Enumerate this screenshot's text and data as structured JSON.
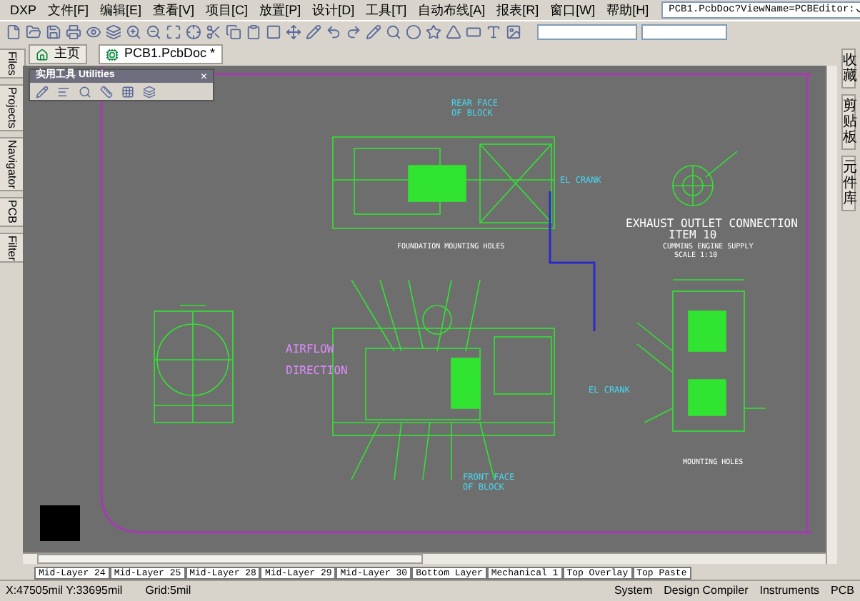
{
  "menu": [
    "DXP",
    "文件[F]",
    "编辑[E]",
    "查看[V]",
    "项目[C]",
    "放置[P]",
    "设计[D]",
    "工具[T]",
    "自动布线[A]",
    "报表[R]",
    "窗口[W]",
    "帮助[H]"
  ],
  "path_combo": {
    "value": "PCB1.PcbDoc?ViewName=PCBEditor:"
  },
  "document_tabs": [
    {
      "label": "主页",
      "selected": false
    },
    {
      "label": "PCB1.PcbDoc *",
      "selected": true
    }
  ],
  "left_panel_tabs": [
    "Files",
    "Projects",
    "Navigator",
    "PCB",
    "Filter"
  ],
  "right_panel_tabs": [
    "收藏",
    "剪贴板",
    "元件库"
  ],
  "utilities_toolbar": {
    "title": "实用工具 Utilities",
    "close": "×"
  },
  "drawing_labels": [
    {
      "kind": "note",
      "text": "REAR FACE"
    },
    {
      "kind": "note",
      "text": "OF BLOCK"
    },
    {
      "kind": "note",
      "text": "EL CRANK"
    },
    {
      "kind": "plain",
      "text": "FOUNDATION MOUNTING HOLES"
    },
    {
      "kind": "title",
      "text": "EXHAUST OUTLET CONNECTION"
    },
    {
      "kind": "title",
      "text": "ITEM 10"
    },
    {
      "kind": "plain",
      "text": "CUMMINS ENGINE SUPPLY"
    },
    {
      "kind": "plain",
      "text": "SCALE 1:10"
    },
    {
      "kind": "airflow",
      "text": "AIRFLOW"
    },
    {
      "kind": "airflow",
      "text": "DIRECTION"
    },
    {
      "kind": "note",
      "text": "EL CRANK"
    },
    {
      "kind": "note",
      "text": "FRONT FACE"
    },
    {
      "kind": "note",
      "text": "OF BLOCK"
    },
    {
      "kind": "plain",
      "text": "MOUNTING HOLES"
    }
  ],
  "layer_tabs": [
    "Mid-Layer 24",
    "Mid-Layer 25",
    "Mid-Layer 28",
    "Mid-Layer 29",
    "Mid-Layer 30",
    "Bottom Layer",
    "Mechanical 1",
    "Top Overlay",
    "Top Paste"
  ],
  "status_bar": {
    "coordinates": "X:47505mil Y:33695mil",
    "grid": "Grid:5mil",
    "panels": [
      "System",
      "Design Compiler",
      "Instruments",
      "PCB"
    ]
  }
}
